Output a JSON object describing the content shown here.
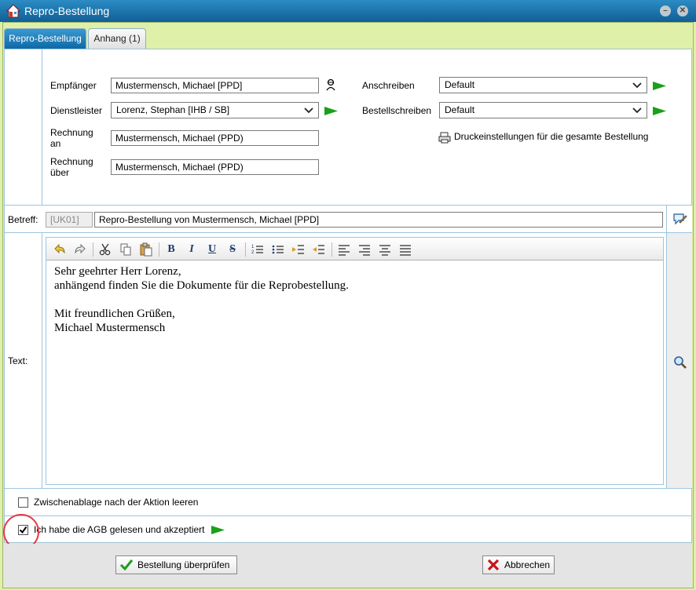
{
  "window": {
    "title": "Repro-Bestellung",
    "minimize_label": "–",
    "close_label": "✕"
  },
  "tabs": [
    {
      "label": "Repro-Bestellung",
      "active": true
    },
    {
      "label": "Anhang (1)",
      "active": false
    }
  ],
  "form": {
    "empfaenger_label": "Empfänger",
    "empfaenger_value": "Mustermensch, Michael [PPD]",
    "dienstleister_label": "Dienstleister",
    "dienstleister_value": "Lorenz, Stephan [IHB / SB]",
    "rechnung_an_label_1": "Rechnung",
    "rechnung_an_label_2": "an",
    "rechnung_an_value": "Mustermensch, Michael (PPD)",
    "rechnung_ueber_label_1": "Rechnung",
    "rechnung_ueber_label_2": "über",
    "rechnung_ueber_value": "Mustermensch, Michael (PPD)",
    "anschreiben_label": "Anschreiben",
    "anschreiben_value": "Default",
    "bestellschreiben_label": "Bestellschreiben",
    "bestellschreiben_value": "Default",
    "druck_link": "Druckeinstellungen für die gesamte Bestellung"
  },
  "betreff": {
    "label": "Betreff:",
    "code": "[UK01]",
    "value": "Repro-Bestellung von Mustermensch, Michael [PPD]"
  },
  "text": {
    "label": "Text:",
    "content": "Sehr geehrter Herr Lorenz,\nanhängend finden Sie die Dokumente für die Reprobestellung.\n\nMit freundlichen Grüßen,\nMichael Mustermensch"
  },
  "toolbar": {
    "bold": "B",
    "italic": "I",
    "underline": "U",
    "strike": "S"
  },
  "options": {
    "zwischenablage_label": "Zwischenablage nach der Aktion leeren",
    "zwischenablage_checked": false,
    "agb_label": "Ich habe die AGB gelesen und akzeptiert",
    "agb_checked": true
  },
  "buttons": {
    "pruefen": "Bestellung überprüfen",
    "abbrechen": "Abbrechen"
  },
  "colors": {
    "accent_blue": "#0e6aa6",
    "background_green": "#dff0a9",
    "go_arrow_green": "#1aa01a",
    "highlight_red": "#e53c48"
  }
}
